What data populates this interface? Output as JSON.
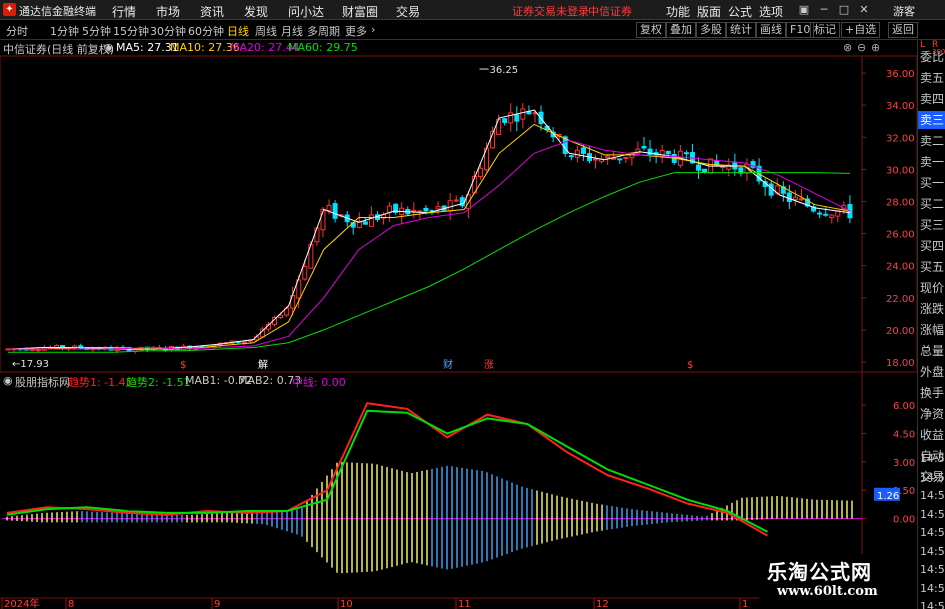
{
  "titlebar": {
    "app_title": "通达信金融终端",
    "menu": [
      "行情",
      "市场",
      "资讯",
      "发现",
      "问小达",
      "财富圈",
      "交易"
    ],
    "warning": "证券交易未登录",
    "broker": "中信证券",
    "right_menu": [
      "功能",
      "版面",
      "公式",
      "选项"
    ],
    "guest": "游客"
  },
  "toolbar": {
    "tabs": [
      "分时",
      "1分钟",
      "5分钟",
      "15分钟",
      "30分钟",
      "60分钟",
      "日线",
      "周线",
      "月线",
      "多周期",
      "更多"
    ],
    "active_tab": "日线",
    "right_buttons": [
      "复权",
      "叠加",
      "多股",
      "统计",
      "画线",
      "F10",
      "标记",
      "+自选",
      "返回"
    ]
  },
  "main_info": {
    "stock": "中信证券(日线 前复权)",
    "ma5": "MA5: 27.31",
    "ma10": "MA10: 27.36",
    "ma20": "MA20: 27.44",
    "ma60": "MA60: 29.75",
    "colors": {
      "ma5": "#ffffff",
      "ma10": "#ffd400",
      "ma20": "#e000e0",
      "ma60": "#00e000"
    }
  },
  "ind_info": {
    "name": "股朋指标网",
    "t1": "趋势1: -1.45",
    "t2": "趋势2: -1.51",
    "mab1": "MAB1: -0.72",
    "mab2": "MAB2: 0.73",
    "zx": "中线: 0.00"
  },
  "right_panel": {
    "corner": [
      "L",
      "R",
      "300"
    ],
    "items": [
      "委比",
      "卖五",
      "卖四",
      "卖三",
      "卖二",
      "卖一",
      "买一",
      "买二",
      "买三",
      "买四",
      "买五",
      "现价",
      "涨跌",
      "涨幅",
      "总量",
      "外盘",
      "换手",
      "净资",
      "收益",
      "自动",
      "交易"
    ],
    "times": [
      "14:56",
      "14:56",
      "14:56",
      "14:56",
      "14:56",
      "14:56",
      "14:56",
      "14:56",
      "14:56"
    ]
  },
  "chart_data": [
    {
      "type": "candlestick",
      "title": "中信证券(日线 前复权)",
      "ylim": [
        17.5,
        37
      ],
      "y_ticks": [
        "36.00",
        "34.00",
        "32.00",
        "30.00",
        "28.00",
        "26.00",
        "24.00",
        "22.00",
        "20.00",
        "18.00"
      ],
      "high_label": "36.25",
      "low_label": "17.93",
      "markers": [
        "$",
        "解",
        "财",
        "涨",
        "$"
      ],
      "series": [
        {
          "name": "MA5",
          "color": "#ffffff",
          "values": [
            18.8,
            18.9,
            18.9,
            18.8,
            18.8,
            18.9,
            19.1,
            19.4,
            21.5,
            27.5,
            26.7,
            27.4,
            27.3,
            27.9,
            33.2,
            33.7,
            31.0,
            30.6,
            31.1,
            30.8,
            30.2,
            30.2,
            28.4,
            27.6,
            27.3
          ]
        },
        {
          "name": "MA10",
          "color": "#ffd400",
          "values": [
            18.8,
            18.8,
            18.9,
            18.9,
            18.8,
            18.8,
            19.0,
            19.2,
            20.5,
            25.0,
            27.0,
            27.0,
            27.3,
            27.5,
            31.0,
            32.8,
            31.8,
            30.9,
            30.9,
            30.7,
            30.3,
            30.2,
            29.0,
            27.8,
            27.4
          ]
        },
        {
          "name": "MA20",
          "color": "#e000e0",
          "values": [
            18.8,
            18.8,
            18.8,
            18.8,
            18.9,
            18.8,
            18.9,
            19.0,
            19.6,
            22.0,
            25.0,
            26.5,
            27.0,
            27.3,
            29.0,
            31.0,
            31.8,
            31.2,
            30.9,
            30.8,
            30.6,
            30.4,
            29.6,
            28.5,
            27.4
          ]
        },
        {
          "name": "MA60",
          "color": "#00e000",
          "values": [
            18.6,
            18.6,
            18.6,
            18.6,
            18.7,
            18.7,
            18.8,
            18.9,
            19.2,
            20.0,
            20.9,
            21.8,
            22.7,
            23.8,
            25.0,
            26.2,
            27.3,
            28.3,
            29.2,
            29.8,
            29.8,
            29.8,
            29.8,
            29.8,
            29.75
          ]
        }
      ]
    },
    {
      "type": "bar",
      "title": "股朋指标网",
      "ylim": [
        -4.2,
        6.8
      ],
      "y_ticks": [
        "6.00",
        "4.50",
        "3.00",
        "1.50",
        "0.00"
      ],
      "current_label": "1.26",
      "series": [
        {
          "name": "趋势1",
          "color": "#ff2020",
          "values": [
            0.3,
            0.6,
            0.5,
            0.3,
            0.2,
            0.4,
            0.3,
            0.4,
            1.5,
            6.1,
            5.8,
            4.3,
            5.5,
            5.0,
            3.5,
            2.3,
            1.6,
            0.8,
            0.3,
            -0.9
          ]
        },
        {
          "name": "趋势2",
          "color": "#00e000",
          "values": [
            0.2,
            0.5,
            0.6,
            0.4,
            0.3,
            0.3,
            0.4,
            0.4,
            1.0,
            5.7,
            5.6,
            4.5,
            5.3,
            5.0,
            3.8,
            2.6,
            1.8,
            1.0,
            0.4,
            -0.7
          ]
        }
      ],
      "histogram": {
        "values": [
          0.1,
          0.3,
          0.4,
          0.3,
          0.2,
          0.2,
          0.3,
          0.3,
          0.5,
          3.0,
          2.9,
          2.4,
          2.8,
          2.5,
          1.7,
          1.2,
          0.8,
          0.5,
          0.3,
          0.1,
          1.1,
          1.2,
          1.0,
          0.95
        ],
        "neg_values": [
          -0.1,
          -0.2,
          -0.2,
          -0.2,
          -0.2,
          -0.2,
          -0.2,
          -0.3,
          -0.9,
          -2.9,
          -2.8,
          -2.3,
          -2.7,
          -2.3,
          -1.6,
          -1.1,
          -0.7,
          -0.4,
          -0.2,
          -0.1,
          -0.1,
          0,
          0,
          0
        ],
        "pos_color": "#ffff66",
        "neg_color": "#44aaff"
      },
      "x_ticks": [
        "2024年",
        "8",
        "9",
        "10",
        "11",
        "12",
        "1"
      ]
    }
  ],
  "watermark": {
    "line1": "乐淘公式网",
    "line2": "www.60lt.com"
  }
}
